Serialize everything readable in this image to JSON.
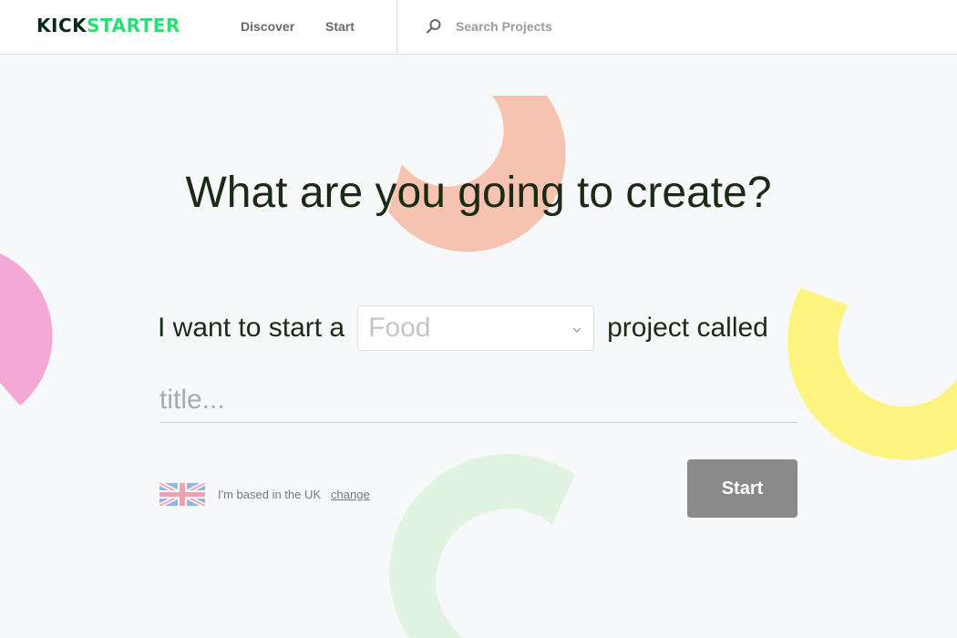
{
  "header": {
    "logo_part1": "KICK",
    "logo_part2": "STARTER",
    "nav": {
      "discover": "Discover",
      "start": "Start"
    },
    "search": {
      "placeholder": "Search Projects",
      "icon": "search-icon"
    }
  },
  "main": {
    "headline": "What are you going to create?",
    "sentence_prefix": "I want to start a",
    "category": {
      "selected": "Food",
      "icon": "chevron-down-icon"
    },
    "sentence_suffix": "project called",
    "title_placeholder": "title...",
    "location": {
      "flag": "uk-flag-icon",
      "text": "I'm based in the UK",
      "change_label": "change"
    },
    "start_button": "Start"
  },
  "colors": {
    "brand_dark": "#082a19",
    "brand_green": "#2bde73",
    "button_gray": "#8a8a8a",
    "deco_salmon": "#f7c3b1",
    "deco_pink": "#f3a8d6",
    "deco_yellow": "#fdf47f",
    "deco_mint": "#e1f3e1"
  }
}
